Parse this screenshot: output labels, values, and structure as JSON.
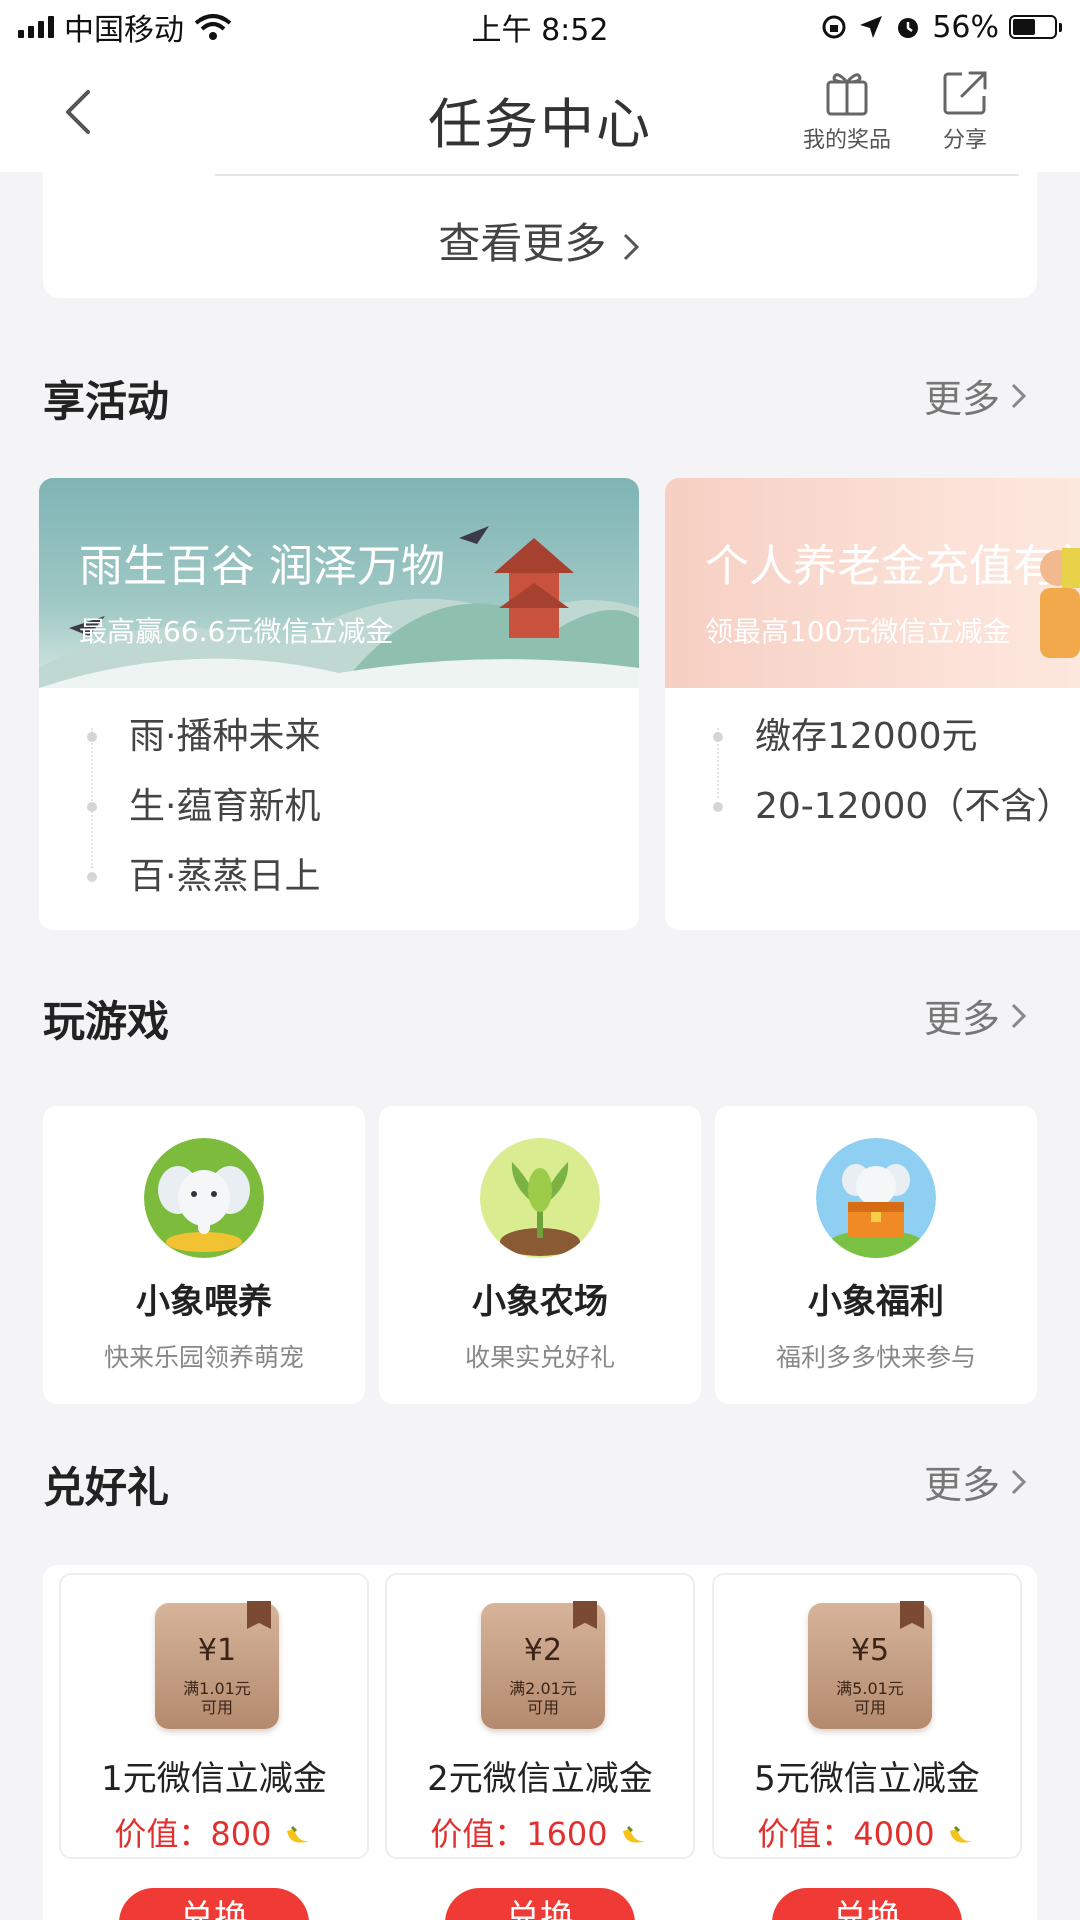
{
  "status_bar": {
    "carrier": "中国移动",
    "time": "上午 8:52",
    "battery_percent": "56%",
    "battery_level": 0.56,
    "icons": [
      "signal-icon",
      "wifi-icon",
      "rotation-lock-icon",
      "location-icon",
      "alarm-icon",
      "battery-icon"
    ]
  },
  "nav": {
    "title": "任务中心",
    "my_prizes_label": "我的奖品",
    "share_label": "分享",
    "icons": [
      "back-icon",
      "gift-icon",
      "share-icon"
    ]
  },
  "top_card": {
    "view_more": "查看更多"
  },
  "sections": {
    "activities": {
      "title": "享活动",
      "more": "更多"
    },
    "games": {
      "title": "玩游戏",
      "more": "更多"
    },
    "gifts": {
      "title": "兑好礼",
      "more": "更多"
    }
  },
  "activities": [
    {
      "title": "雨生百谷 润泽万物",
      "subtitle": "最高赢66.6元微信立减金",
      "items": [
        "雨·播种未来",
        "生·蕴育新机",
        "百·蒸蒸日上"
      ]
    },
    {
      "title": "个人养老金充值有礼",
      "subtitle": "领最高100元微信立减金",
      "items": [
        "缴存12000元",
        "20-12000（不含）"
      ]
    }
  ],
  "games": [
    {
      "name": "小象喂养",
      "desc": "快来乐园领养萌宠"
    },
    {
      "name": "小象农场",
      "desc": "收果实兑好礼"
    },
    {
      "name": "小象福利",
      "desc": "福利多多快来参与"
    }
  ],
  "gifts": [
    {
      "amount": "¥1",
      "cond1": "满1.01元",
      "cond2": "可用",
      "name": "1元微信立减金",
      "price_label": "价值：",
      "price": "800",
      "button": "兑换"
    },
    {
      "amount": "¥2",
      "cond1": "满2.01元",
      "cond2": "可用",
      "name": "2元微信立减金",
      "price_label": "价值：",
      "price": "1600",
      "button": "兑换"
    },
    {
      "amount": "¥5",
      "cond1": "满5.01元",
      "cond2": "可用",
      "name": "5元微信立减金",
      "price_label": "价值：",
      "price": "4000",
      "button": "兑换"
    }
  ],
  "colors": {
    "accent_red": "#ef3a35",
    "price_red": "#e0312f",
    "coupon_brown": "#b48a6e"
  }
}
